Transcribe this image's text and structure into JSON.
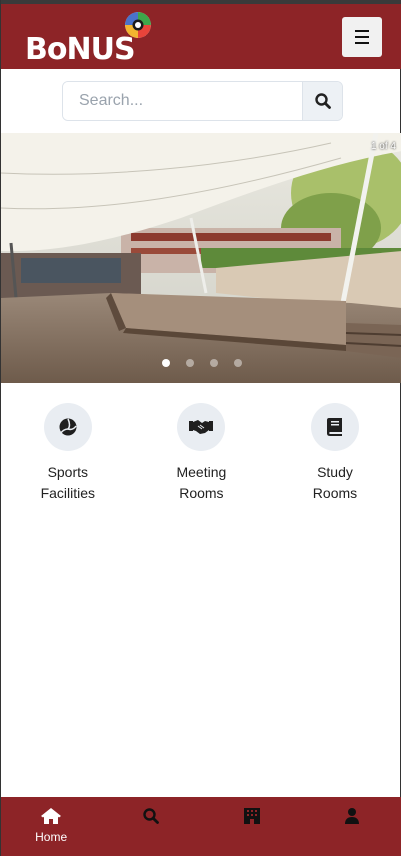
{
  "brand": {
    "logo_text": "BoNUS",
    "color": "#8d2427"
  },
  "header": {
    "menu_icon": "hamburger-icon"
  },
  "search": {
    "placeholder": "Search...",
    "icon": "search-icon"
  },
  "carousel": {
    "counter": "1 of 4",
    "slide_count": 4,
    "active_index": 0
  },
  "categories": [
    {
      "label": "Sports\nFacilities",
      "icon": "volleyball-icon"
    },
    {
      "label": "Meeting\nRooms",
      "icon": "handshake-icon"
    },
    {
      "label": "Study\nRooms",
      "icon": "book-icon"
    }
  ],
  "bottom_nav": [
    {
      "label": "Home",
      "icon": "home-icon"
    },
    {
      "label": "",
      "icon": "search-icon"
    },
    {
      "label": "",
      "icon": "building-icon"
    },
    {
      "label": "",
      "icon": "user-icon"
    }
  ]
}
